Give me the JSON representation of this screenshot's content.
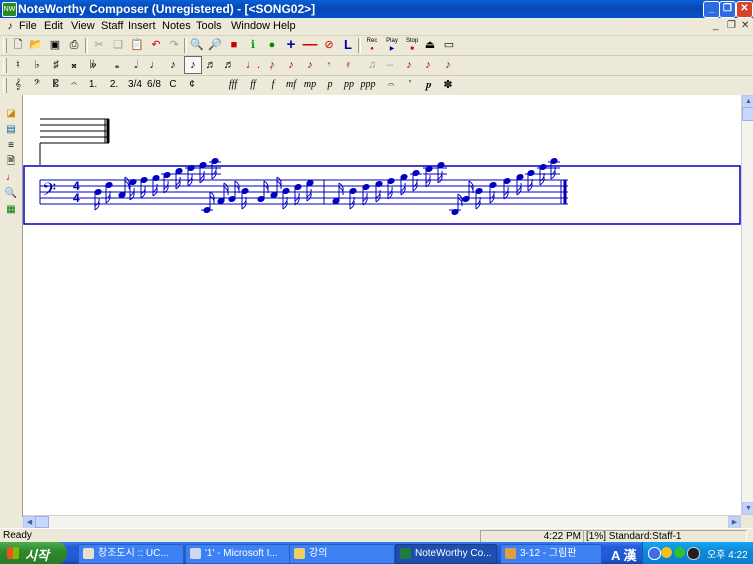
{
  "window": {
    "title": "NoteWorthy Composer (Unregistered) - [<SONG02>]",
    "app_icon": "NW"
  },
  "menu": [
    {
      "label": "File",
      "key": "F"
    },
    {
      "label": "Edit",
      "key": "E"
    },
    {
      "label": "View",
      "key": "V"
    },
    {
      "label": "Staff",
      "key": "S"
    },
    {
      "label": "Insert",
      "key": "I"
    },
    {
      "label": "Notes",
      "key": "N"
    },
    {
      "label": "Tools",
      "key": "T"
    },
    {
      "label": "Window",
      "key": "W"
    },
    {
      "label": "Help",
      "key": "H"
    }
  ],
  "toolbar1": {
    "buttons": [
      "new-icon",
      "open-icon",
      "save-icon",
      "print-icon",
      "cut-icon",
      "copy-icon",
      "paste-icon",
      "undo-icon",
      "redo-icon",
      "zoom-in-icon",
      "zoom-out-icon",
      "stop-icon",
      "info-icon",
      "globe-icon",
      "plus-icon",
      "minus-icon",
      "no-icon",
      "letter-l-icon"
    ],
    "transport": {
      "rec": "Rec",
      "play": "Play",
      "stop": "Stop"
    }
  },
  "toolbar2": {
    "glyphs": [
      "♮",
      "♭",
      "♯",
      "𝄪",
      "𝄫",
      "𝅝",
      "𝅗𝅥",
      "♩",
      "♪",
      "♪",
      "♬",
      "♬",
      "♩.",
      "♪̣",
      "♪",
      "♪",
      "𝄾",
      "𝄿",
      "♫",
      "–",
      "♪",
      "♪",
      "♪"
    ]
  },
  "toolbar3": {
    "glyphs": [
      "𝄞",
      "𝄢",
      "𝄡",
      "𝄐",
      "1.",
      "2.",
      "3/4",
      "6/8",
      "C",
      "¢"
    ],
    "dynamics": [
      "fff",
      "ff",
      "f",
      "mf",
      "mp",
      "p",
      "pp",
      "ppp"
    ],
    "extra": [
      "𝄐",
      "ʼ",
      "𝆏",
      "✽"
    ]
  },
  "sidebar": [
    "layers-icon",
    "book-icon",
    "staff-icon",
    "preview-icon",
    "note-icon",
    "find-icon",
    "grid-icon"
  ],
  "score": {
    "time_signature": {
      "top": "4",
      "bottom": "4"
    },
    "clef": "bass"
  },
  "status": {
    "left": "Ready",
    "time": "4:22 PM",
    "staff": "[1%] Standard:Staff-1"
  },
  "taskbar": {
    "start": "시작",
    "tasks": [
      {
        "label": "창조도시 :: UC...",
        "color": "#E8E0C8",
        "active": false
      },
      {
        "label": "'1' - Microsoft I...",
        "color": "#D0D8F0",
        "active": false
      },
      {
        "label": "강의",
        "color": "#F0D060",
        "active": false
      },
      {
        "label": "NoteWorthy Co...",
        "color": "#1E7C3E",
        "active": true
      },
      {
        "label": "3-12 - 그림판",
        "color": "#E0A040",
        "active": false
      }
    ],
    "lang": "A 漢",
    "clock": "오후 4:22"
  }
}
